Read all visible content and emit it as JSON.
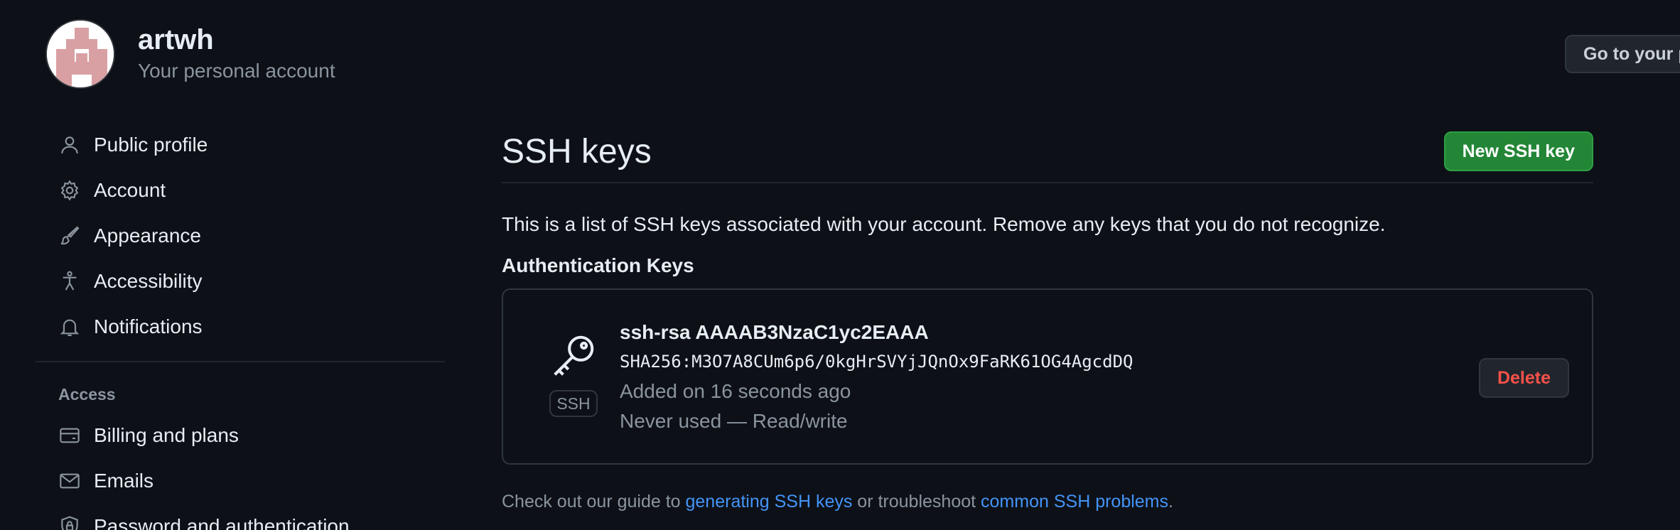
{
  "header": {
    "username": "artwh",
    "subtitle": "Your personal account",
    "go_button_label": "Go to your personal profile"
  },
  "sidebar": {
    "items": [
      {
        "label": "Public profile",
        "icon": "person-icon"
      },
      {
        "label": "Account",
        "icon": "gear-icon"
      },
      {
        "label": "Appearance",
        "icon": "paintbrush-icon"
      },
      {
        "label": "Accessibility",
        "icon": "accessibility-icon"
      },
      {
        "label": "Notifications",
        "icon": "bell-icon"
      }
    ],
    "access_heading": "Access",
    "access_items": [
      {
        "label": "Billing and plans",
        "icon": "credit-card-icon"
      },
      {
        "label": "Emails",
        "icon": "mail-icon"
      },
      {
        "label": "Password and authentication",
        "icon": "shield-lock-icon"
      }
    ]
  },
  "main": {
    "title": "SSH keys",
    "new_key_button": "New SSH key",
    "description": "This is a list of SSH keys associated with your account. Remove any keys that you do not recognize.",
    "section_heading": "Authentication Keys",
    "key": {
      "icon": "key-icon",
      "badge": "SSH",
      "title": "ssh-rsa AAAAB3NzaC1yc2EAAA",
      "fingerprint": "SHA256:M3O7A8CUm6p6/0kgHrSVYjJQnOx9FaRK61OG4AgcdDQ",
      "added": "Added on 16 seconds ago",
      "usage": "Never used — Read/write",
      "delete_button": "Delete"
    },
    "footer": {
      "prefix": "Check out our guide to ",
      "link1": "generating SSH keys",
      "middle": " or troubleshoot ",
      "link2": "common SSH problems",
      "suffix": "."
    }
  },
  "colors": {
    "background": "#0d1117",
    "primary_button": "#238636",
    "danger_text": "#f85149",
    "link": "#4493f8",
    "avatar_pattern": "#d9a0a3"
  }
}
